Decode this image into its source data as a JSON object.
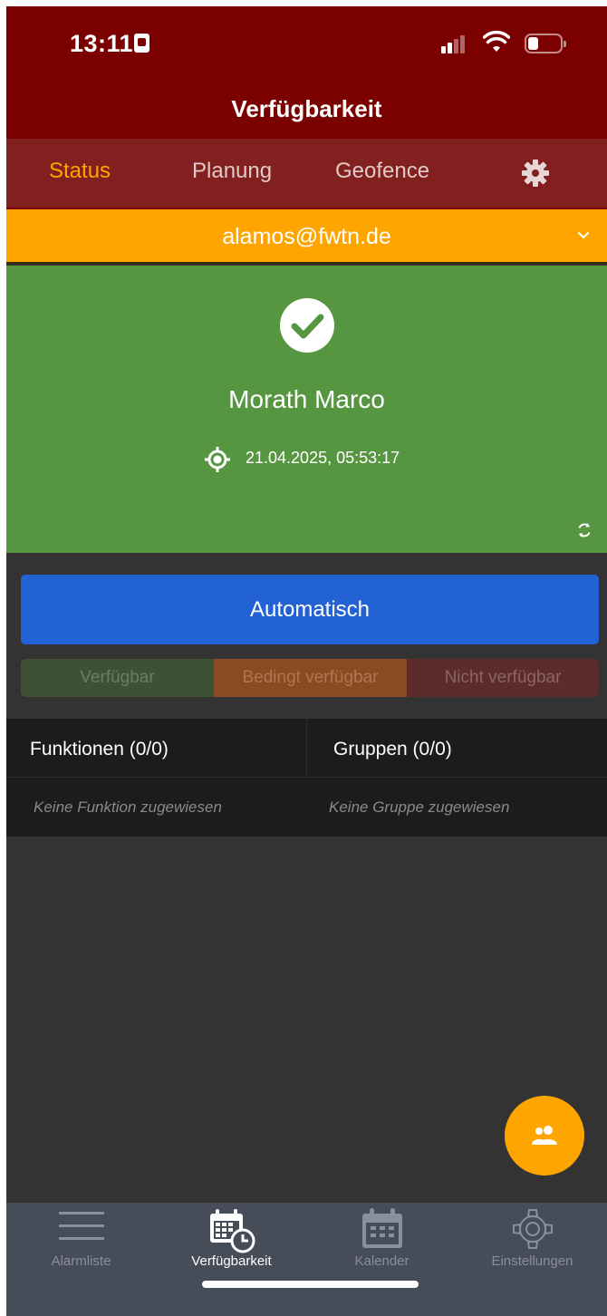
{
  "status_bar": {
    "time": "13:11"
  },
  "header": {
    "title": "Verfügbarkeit"
  },
  "tabs": [
    {
      "label": "Status",
      "active": true
    },
    {
      "label": "Planung",
      "active": false
    },
    {
      "label": "Geofence",
      "active": false
    },
    {
      "icon": "gear-icon",
      "active": false
    }
  ],
  "account": {
    "email": "alamos@fwtn.de"
  },
  "status_card": {
    "name": "Morath Marco",
    "timestamp": "21.04.2025, 05:53:17",
    "status_color": "#579641"
  },
  "mode_button": {
    "label": "Automatisch",
    "color": "#2362d4"
  },
  "availability_options": [
    {
      "label": "Verfügbar",
      "color": "#3e5134"
    },
    {
      "label": "Bedingt verfügbar",
      "color": "#8a4a22"
    },
    {
      "label": "Nicht verfügbar",
      "color": "#5c2c2c"
    }
  ],
  "info": {
    "functions_header": "Funktionen (0/0)",
    "groups_header": "Gruppen (0/0)",
    "functions_empty": "Keine Funktion zugewiesen",
    "groups_empty": "Keine Gruppe zugewiesen"
  },
  "bottom_nav": [
    {
      "label": "Alarmliste",
      "icon": "list-icon",
      "active": false
    },
    {
      "label": "Verfügbarkeit",
      "icon": "calendar-clock-icon",
      "active": true
    },
    {
      "label": "Kalender",
      "icon": "calendar-icon",
      "active": false
    },
    {
      "label": "Einstellungen",
      "icon": "gear-icon",
      "active": false
    }
  ],
  "colors": {
    "header": "#7b0000",
    "tabs": "#821f1f",
    "accent": "#ffa500"
  }
}
